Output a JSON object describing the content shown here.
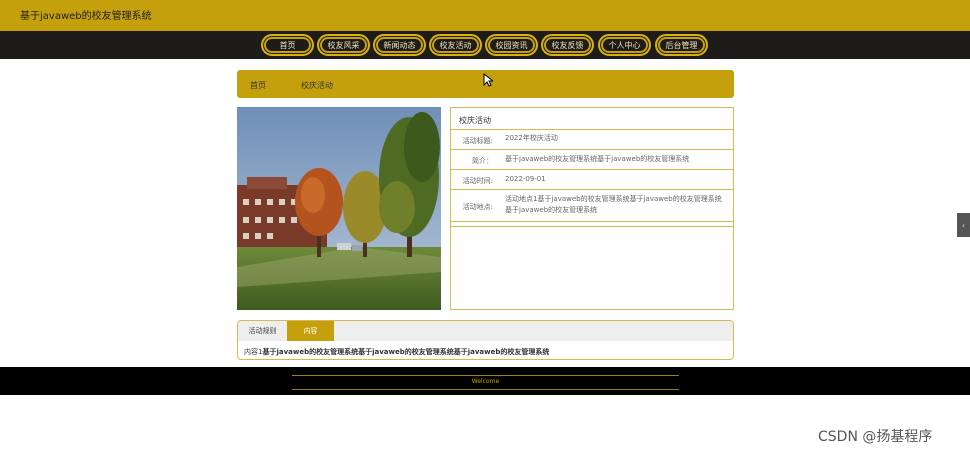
{
  "site": {
    "title": "基于javaweb的校友管理系统"
  },
  "nav": [
    {
      "label": "首页"
    },
    {
      "label": "校友风采"
    },
    {
      "label": "新闻动态"
    },
    {
      "label": "校友活动"
    },
    {
      "label": "校园资讯"
    },
    {
      "label": "校友反馈"
    },
    {
      "label": "个人中心"
    },
    {
      "label": "后台管理"
    }
  ],
  "breadcrumb": {
    "home": "首页",
    "current": "校庆活动"
  },
  "detail": {
    "title": "校庆活动",
    "rows": [
      {
        "label": "活动标题:",
        "value": "2022年校庆活动"
      },
      {
        "label": "简介：",
        "value": "基于javaweb的校友管理系统基于javaweb的校友管理系统"
      },
      {
        "label": "活动时间:",
        "value": "2022-09-01"
      },
      {
        "label": "活动地点:",
        "value": "活动地点1基于javaweb的校友管理系统基于javaweb的校友管理系统基于javaweb的校友管理系统"
      }
    ]
  },
  "tabs": {
    "rules": "活动规则",
    "content": "内容"
  },
  "content": {
    "prefix": "内容1",
    "body": "基于javaweb的校友管理系统基于javaweb的校友管理系统基于javaweb的校友管理系统"
  },
  "footer": {
    "text": "Welcome"
  },
  "side": {
    "toggle": "‹"
  },
  "watermark": "CSDN @扬基程序",
  "colors": {
    "accent": "#c4a00c",
    "nav_bg": "#1e1c1b",
    "footer_bg": "#000000"
  }
}
